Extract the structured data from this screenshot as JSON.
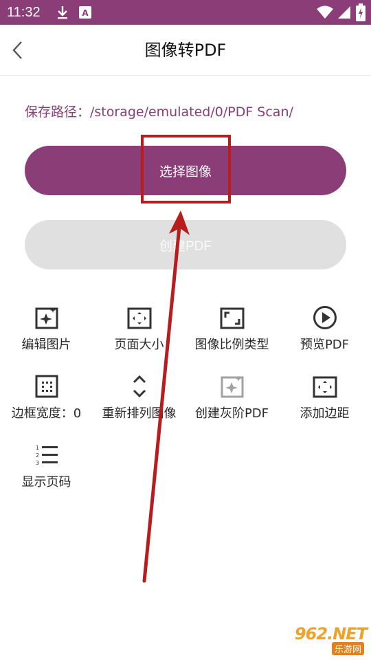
{
  "status_bar": {
    "time": "11:32",
    "icons": [
      "download-icon",
      "a-icon",
      "wifi-icon",
      "signal-icon",
      "battery-icon"
    ]
  },
  "app_bar": {
    "title": "图像转PDF",
    "back_icon": "chevron-left-icon"
  },
  "save_path": "保存路径：/storage/emulated/0/PDF Scan/",
  "buttons": {
    "select_image": "选择图像",
    "create_pdf": "创建PDF"
  },
  "grid": [
    {
      "label": "编辑图片",
      "icon": "edit-image-icon"
    },
    {
      "label": "页面大小",
      "icon": "page-size-icon"
    },
    {
      "label": "图像比例类型",
      "icon": "aspect-ratio-icon"
    },
    {
      "label": "预览PDF",
      "icon": "play-icon"
    },
    {
      "label": "边框宽度：0",
      "icon": "border-width-icon"
    },
    {
      "label": "重新排列图像",
      "icon": "rearrange-icon"
    },
    {
      "label": "创建灰阶PDF",
      "icon": "grayscale-icon"
    },
    {
      "label": "添加边距",
      "icon": "margin-icon"
    },
    {
      "label": "显示页码",
      "icon": "numbered-list-icon"
    }
  ],
  "watermark": {
    "logo": "962.NET",
    "sub": "乐游网"
  },
  "colors": {
    "accent": "#8a3d77",
    "disabled": "#e0e0e0",
    "annotation": "#b81d1d"
  }
}
